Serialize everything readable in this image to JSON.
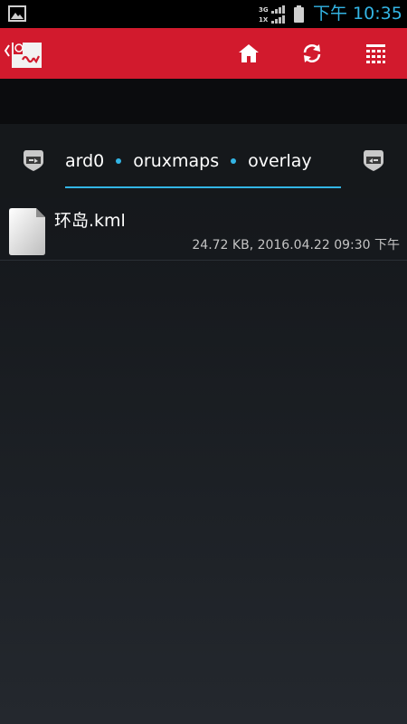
{
  "status_bar": {
    "time": "下午 10:35",
    "network_top": "3G",
    "network_bottom": "1X",
    "icons": [
      "gallery-icon",
      "signal-icon",
      "battery-icon"
    ]
  },
  "action_bar": {
    "color": "#d21a2d",
    "icons": [
      "up-caret-icon",
      "app-logo",
      "home-icon",
      "refresh-icon",
      "grid-icon"
    ]
  },
  "breadcrumb": {
    "accent": "#33b5e5",
    "items": [
      "ard0",
      "oruxmaps",
      "overlay"
    ],
    "icons": [
      "shield-left-icon",
      "shield-right-icon"
    ]
  },
  "files": [
    {
      "name": "环岛.kml",
      "meta": "24.72 KB, 2016.04.22 09:30 下午",
      "icon": "document-icon"
    }
  ]
}
